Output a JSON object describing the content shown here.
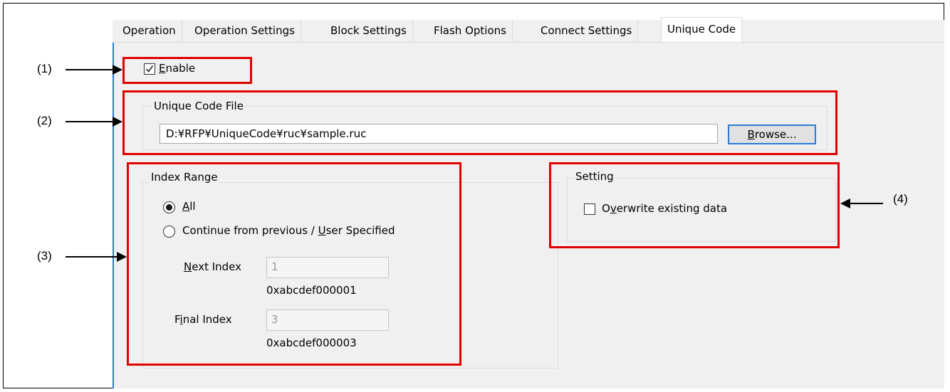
{
  "tabs": [
    {
      "label": "Operation",
      "active": false
    },
    {
      "label": "Operation Settings",
      "active": false
    },
    {
      "label": "Block Settings",
      "active": false
    },
    {
      "label": "Flash Options",
      "active": false
    },
    {
      "label": "Connect Settings",
      "active": false
    },
    {
      "label": "Unique Code",
      "active": true
    }
  ],
  "enable": {
    "pre": "",
    "mnemonic": "E",
    "post": "nable",
    "checked": true
  },
  "unique_code_file": {
    "group_label": "Unique Code File",
    "path_value": "D:¥RFP¥UniqueCode¥ruc¥sample.ruc",
    "browse": {
      "mnemonic": "B",
      "rest": "rowse..."
    }
  },
  "index_range": {
    "group_label": "Index Range",
    "option_all": {
      "mnemonic": "A",
      "rest": "ll",
      "selected": true
    },
    "option_continue": {
      "pre": "Continue from previous / ",
      "mnemonic": "U",
      "post": "ser Specified",
      "selected": false
    },
    "next_index": {
      "mnemonic": "N",
      "rest": "ext Index",
      "value": "1",
      "hex": "0xabcdef000001"
    },
    "final_index": {
      "pre": "F",
      "mnemonic": "i",
      "post": "nal Index",
      "value": "3",
      "hex": "0xabcdef000003"
    }
  },
  "setting": {
    "group_label": "Setting",
    "overwrite": {
      "pre": "O",
      "mnemonic": "v",
      "post": "erwrite existing data",
      "checked": false
    }
  },
  "callouts": {
    "c1": "(1)",
    "c2": "(2)",
    "c3": "(3)",
    "c4": "(4)"
  },
  "colors": {
    "highlight": "#e00000",
    "focus": "#2b7bd6",
    "panel": "#f0f0f0"
  },
  "icons": {
    "check": "checkmark-icon",
    "arrows": "arrow-icon"
  }
}
